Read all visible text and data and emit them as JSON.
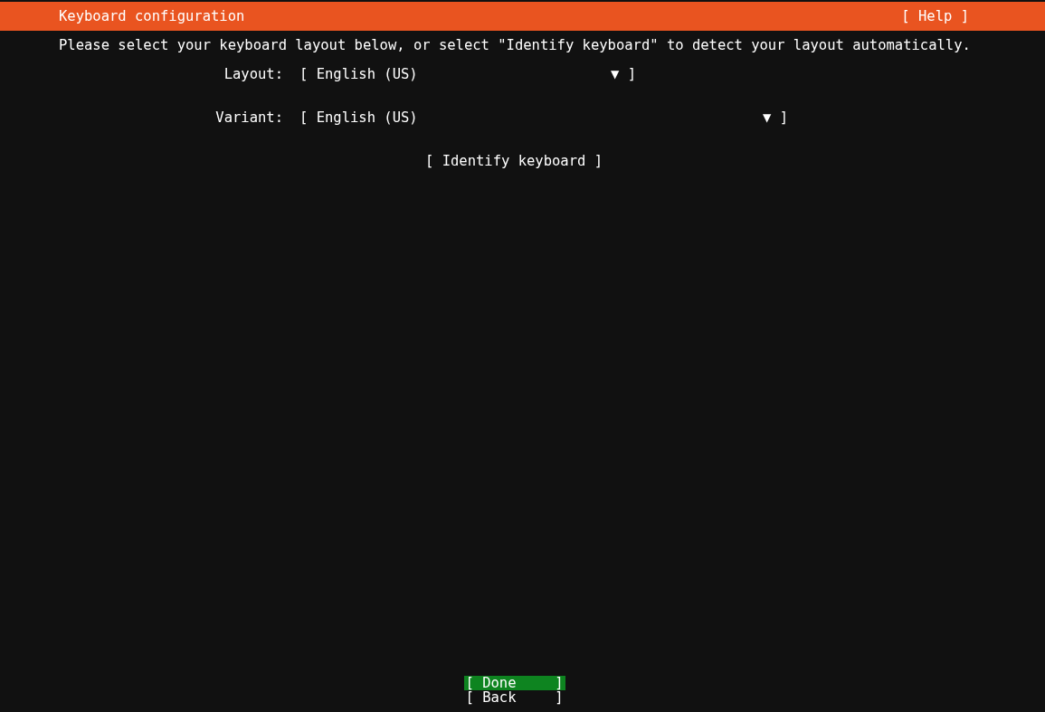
{
  "header": {
    "title": "Keyboard configuration",
    "help": "[ Help ]"
  },
  "instructions": "Please select your keyboard layout below, or select \"Identify keyboard\" to detect your layout automatically.",
  "fields": [
    {
      "label": "Layout:",
      "value": "[ English (US)",
      "end": "▼ ]"
    },
    {
      "label": "Variant:",
      "value": "[ English (US)",
      "end": "▼ ]"
    }
  ],
  "identify_button": "[ Identify keyboard ]",
  "buttons": [
    {
      "label": "[ Done",
      "end": "]",
      "selected": true
    },
    {
      "label": "[ Back",
      "end": "]",
      "selected": false
    }
  ]
}
